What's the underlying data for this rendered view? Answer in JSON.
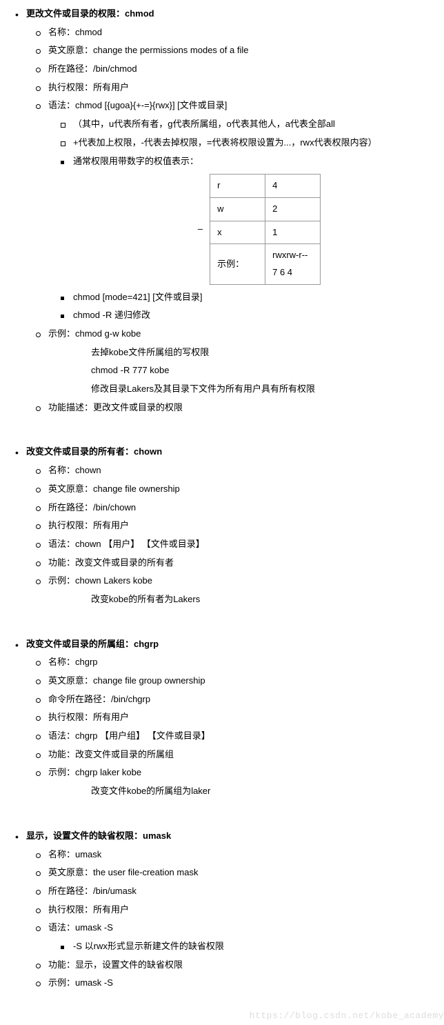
{
  "watermark": "https://blog.csdn.net/kobe_academy",
  "sections": [
    {
      "title_prefix": "更改文件或目录的权限：",
      "title_cmd": "chmod",
      "items": [
        {
          "text": "名称：chmod"
        },
        {
          "text": "英文原意：change the permissions modes  of a file"
        },
        {
          "text": "所在路径：/bin/chmod"
        },
        {
          "text": "执行权限：所有用户"
        },
        {
          "text": "语法：chmod [{ugoa}{+-=}{rwx}] [文件或目录]",
          "l3": [
            "（其中，u代表所有者，g代表所属组，o代表其他人，a代表全部all",
            "       +代表加上权限，-代表去掉权限，=代表将权限设置为...，rwx代表权限内容）"
          ],
          "l4": [
            {
              "text": "通常权限用带数字的权值表示：",
              "table": {
                "rows": [
                  [
                    "r",
                    "4"
                  ],
                  [
                    "w",
                    "2"
                  ],
                  [
                    "x",
                    "1"
                  ],
                  [
                    "示例：",
                    "rwxrw-r--\n7    6    4"
                  ]
                ]
              }
            },
            {
              "text": "chmod [mode=421] [文件或目录]"
            },
            {
              "text": "chmod -R 递归修改"
            }
          ]
        },
        {
          "text": "示例：chmod g-w kobe",
          "sub": [
            "去掉kobe文件所属组的写权限",
            " chmod -R 777 kobe",
            "修改目录Lakers及其目录下文件为所有用户具有所有权限"
          ]
        },
        {
          "text": "功能描述：更改文件或目录的权限"
        }
      ]
    },
    {
      "title_prefix": "改变文件或目录的所有者：",
      "title_cmd": "chown",
      "items": [
        {
          "text": "名称：chown"
        },
        {
          "text": "英文原意：change file ownership"
        },
        {
          "text": "所在路径：/bin/chown"
        },
        {
          "text": "执行权限：所有用户"
        },
        {
          "text": "语法：chown 【用户】 【文件或目录】"
        },
        {
          "text": "功能：改变文件或目录的所有者"
        },
        {
          "text": "示例：chown Lakers kobe",
          "sub": [
            "改变kobe的所有者为Lakers"
          ]
        }
      ]
    },
    {
      "title_prefix": "改变文件或目录的所属组：",
      "title_cmd": "chgrp",
      "items": [
        {
          "text": "名称：chgrp"
        },
        {
          "text": "英文原意：change file group ownership"
        },
        {
          "text": "命令所在路径：/bin/chgrp"
        },
        {
          "text": "执行权限：所有用户"
        },
        {
          "text": "语法：chgrp 【用户组】 【文件或目录】"
        },
        {
          "text": "功能：改变文件或目录的所属组"
        },
        {
          "text": "示例：chgrp laker kobe",
          "sub": [
            "改变文件kobe的所属组为laker"
          ]
        }
      ]
    },
    {
      "title_prefix": "显示，设置文件的缺省权限：",
      "title_cmd": "umask",
      "items": [
        {
          "text": "名称：umask"
        },
        {
          "text": "英文原意：the user file-creation mask"
        },
        {
          "text": "所在路径：/bin/umask"
        },
        {
          "text": "执行权限：所有用户"
        },
        {
          "text": "语法：umask -S",
          "l4": [
            {
              "text": "-S  以rwx形式显示新建文件的缺省权限"
            }
          ]
        },
        {
          "text": "功能：显示，设置文件的缺省权限"
        },
        {
          "text": "示例：umask -S"
        }
      ]
    }
  ]
}
